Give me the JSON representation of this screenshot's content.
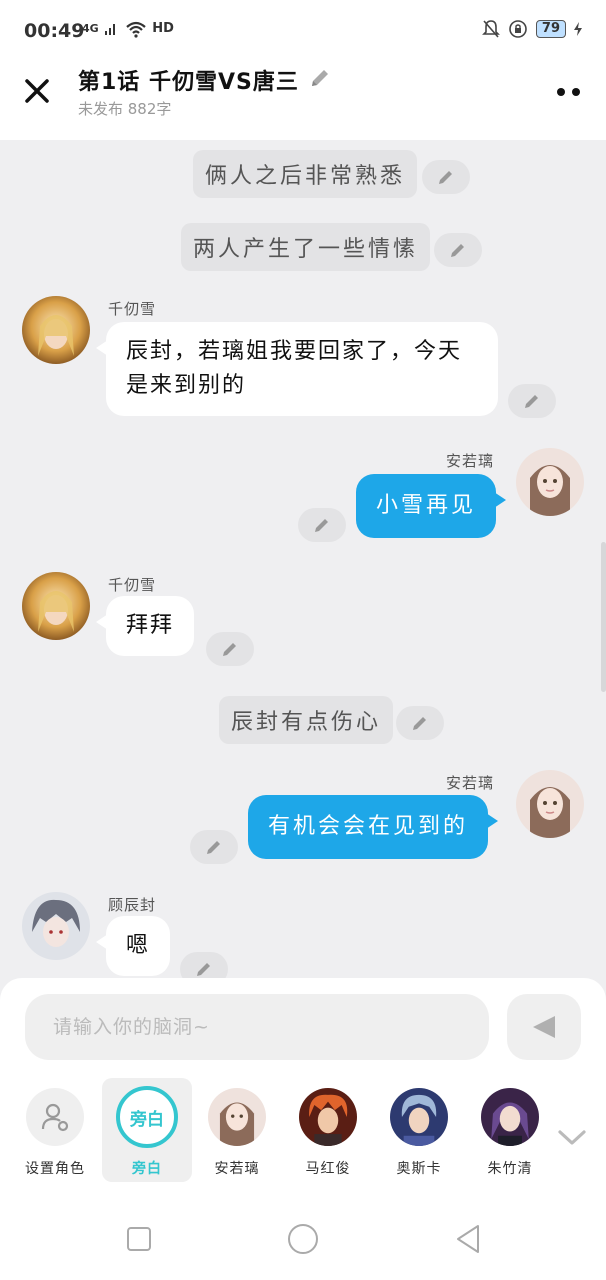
{
  "status": {
    "time": "00:49",
    "network": "4G",
    "hd": "HD",
    "battery": "79"
  },
  "header": {
    "title": "第1话  千仞雪VS唐三",
    "subtitle": "未发布 882字"
  },
  "messages": {
    "n1": "俩人之后非常熟悉",
    "n2": "两人产生了一些情愫",
    "m1": {
      "name": "千仞雪",
      "text": "辰封，若璃姐我要回家了，今天是来到别的"
    },
    "m2": {
      "name": "安若璃",
      "text": "小雪再见"
    },
    "m3": {
      "name": "千仞雪",
      "text": "拜拜"
    },
    "n3": "辰封有点伤心",
    "m4": {
      "name": "安若璃",
      "text": "有机会会在见到的"
    },
    "m5": {
      "name": "顾辰封",
      "text": "嗯"
    }
  },
  "input": {
    "placeholder": "请输入你的脑洞~"
  },
  "roles": {
    "set": "设置角色",
    "narrator": "旁白",
    "narrator_icon": "旁白",
    "r1": "安若璃",
    "r2": "马红俊",
    "r3": "奥斯卡",
    "r4": "朱竹清"
  },
  "colors": {
    "accent": "#1ea7e8",
    "narrator": "#34c6cf"
  }
}
